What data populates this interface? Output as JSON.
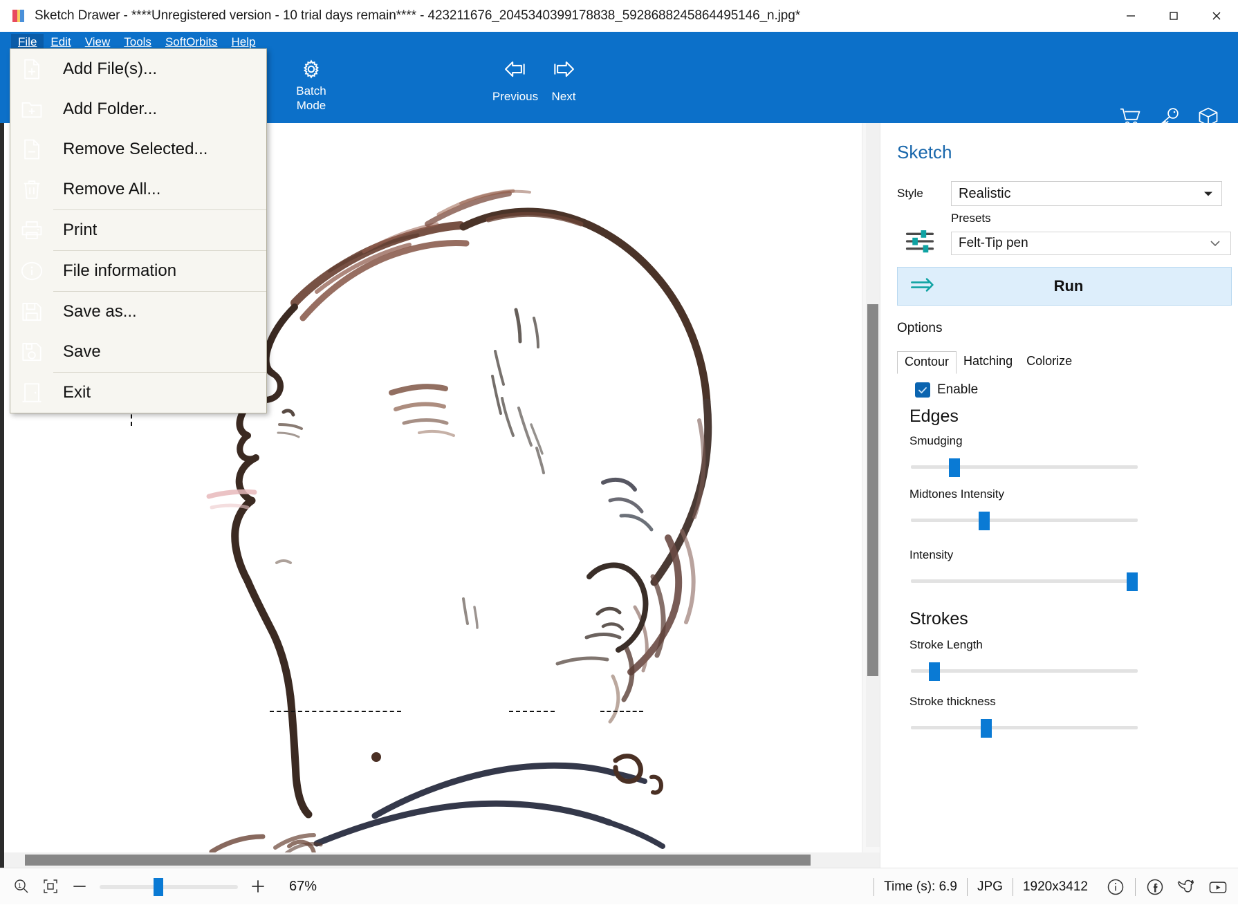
{
  "window": {
    "title": "Sketch Drawer - ****Unregistered version - 10 trial days remain**** - 423211676_2045340399178838_5928688245864495146_n.jpg*",
    "app_icon": "sketch-drawer-icon",
    "minimize_label": "—",
    "maximize_label": "□",
    "close_label": "✕"
  },
  "menubar": {
    "items": [
      {
        "label": "File",
        "active": true
      },
      {
        "label": "Edit",
        "active": false
      },
      {
        "label": "View",
        "active": false
      },
      {
        "label": "Tools",
        "active": false
      },
      {
        "label": "SoftOrbits",
        "active": false
      },
      {
        "label": "Help",
        "active": false
      }
    ]
  },
  "toolbar": {
    "batch_mode_line1": "Batch",
    "batch_mode_line2": "Mode",
    "previous_label": "Previous",
    "next_label": "Next",
    "right_icons": [
      "cart-icon",
      "key-icon",
      "box-icon"
    ],
    "background_color": "#0c70c9"
  },
  "file_menu": {
    "visible": true,
    "items": [
      {
        "label": "Add File(s)...",
        "icon": "file-add-icon",
        "sep_after": false
      },
      {
        "label": "Add Folder...",
        "icon": "folder-add-icon",
        "sep_after": false
      },
      {
        "label": "Remove Selected...",
        "icon": "file-remove-icon",
        "sep_after": false
      },
      {
        "label": "Remove All...",
        "icon": "trash-icon",
        "sep_after": true
      },
      {
        "label": "Print",
        "icon": "printer-icon",
        "sep_after": true
      },
      {
        "label": "File information",
        "icon": "info-icon",
        "sep_after": true
      },
      {
        "label": "Save as...",
        "icon": "save-as-icon",
        "sep_after": false
      },
      {
        "label": "Save",
        "icon": "save-icon",
        "sep_after": true
      },
      {
        "label": "Exit",
        "icon": "exit-door-icon",
        "sep_after": false
      }
    ]
  },
  "panel": {
    "title": "Sketch",
    "style_label": "Style",
    "style_value": "Realistic",
    "presets_label": "Presets",
    "presets_value": "Felt-Tip pen",
    "run_label": "Run",
    "run_icon": "run-arrow-icon",
    "options_label": "Options",
    "tabs": [
      {
        "label": "Contour",
        "active": true
      },
      {
        "label": "Hatching",
        "active": false
      },
      {
        "label": "Colorize",
        "active": false
      }
    ],
    "enable_label": "Enable",
    "enable_checked": true,
    "sections": [
      {
        "heading": "Edges",
        "sliders": [
          {
            "label": "Smudging",
            "percent": 19
          },
          {
            "label": "Midtones Intensity",
            "percent": 31
          },
          {
            "label": "Intensity",
            "percent": 100
          }
        ]
      },
      {
        "heading": "Strokes",
        "sliders": [
          {
            "label": "Stroke Length",
            "percent": 9
          },
          {
            "label": "Stroke thickness",
            "percent": 29
          }
        ]
      }
    ],
    "accent_color": "#0a7ad4",
    "title_color": "#1766ab"
  },
  "statusbar": {
    "zoom_fit_icon": "zoom-actual-size-icon",
    "fit_to_window_icon": "fit-to-window-icon",
    "minus_label": "−",
    "plus_label": "+",
    "zoom_percent": "67%",
    "zoom_slider_percent": 39,
    "time_label": "Time (s): 6.9",
    "format_label": "JPG",
    "dimensions_label": "1920x3412",
    "social_icons": [
      "info-circle-icon",
      "facebook-icon",
      "twitter-icon",
      "youtube-icon"
    ]
  },
  "canvas": {
    "image_name": "pencil-sketch-child-profile",
    "description": "Pencil sketch of a child's head in profile looking upward",
    "background": "#ffffff"
  }
}
